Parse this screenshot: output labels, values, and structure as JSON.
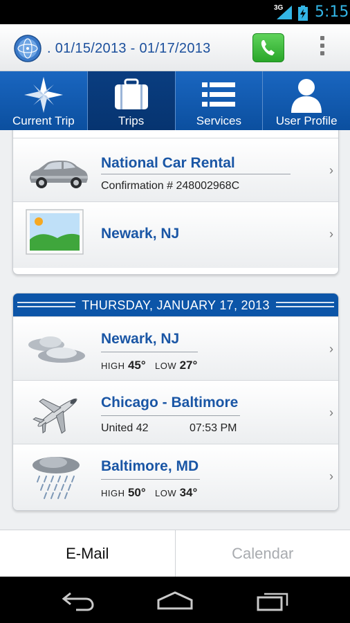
{
  "status_bar": {
    "network": "3G",
    "time": "5:15"
  },
  "header": {
    "date_range": ". 01/15/2013 - 01/17/2013",
    "icons": [
      "globe-icon",
      "phone-icon",
      "overflow-menu-icon"
    ]
  },
  "tabs": [
    {
      "label": "Current Trip",
      "icon": "compass-icon"
    },
    {
      "label": "Trips",
      "icon": "briefcase-icon",
      "active": true
    },
    {
      "label": "Services",
      "icon": "list-icon"
    },
    {
      "label": "User Profile",
      "icon": "user-icon"
    }
  ],
  "card1": {
    "rows": [
      {
        "title": "National Car Rental",
        "subtitle": "Confirmation # 248002968C",
        "icon": "car-icon"
      },
      {
        "title": "Newark, NJ",
        "icon": "landscape-image-icon"
      }
    ]
  },
  "card2": {
    "day_header": "THURSDAY, JANUARY 17, 2013",
    "rows": [
      {
        "title": "Newark, NJ",
        "high_label": "HIGH",
        "high": "45°",
        "low_label": "LOW",
        "low": "27°",
        "icon": "cloudy-icon"
      },
      {
        "title": "Chicago - Baltimore",
        "flight": "United 42",
        "time": "07:53 PM",
        "icon": "airplane-icon"
      },
      {
        "title": "Baltimore, MD",
        "high_label": "HIGH",
        "high": "50°",
        "low_label": "LOW",
        "low": "34°",
        "icon": "rain-icon"
      }
    ]
  },
  "action_bar": {
    "email": "E-Mail",
    "calendar": "Calendar"
  },
  "colors": {
    "brand_blue": "#0c55a8",
    "title_blue": "#1a56a5",
    "status_blue": "#33b5e5",
    "phone_green": "#3cba3a"
  }
}
